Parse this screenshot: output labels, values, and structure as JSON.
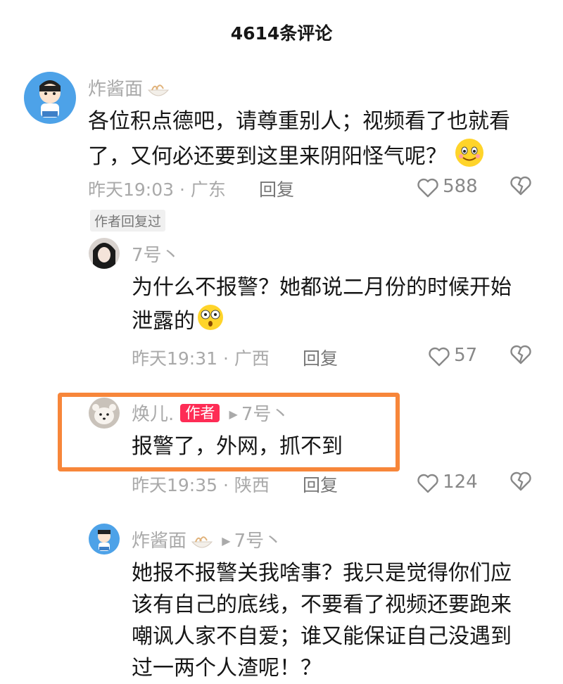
{
  "header": {
    "title": "4614条评论"
  },
  "comments": [
    {
      "user": "炸酱面",
      "text_lines": [
        "各位积点德吧，请尊重别人；视频看了也就看",
        "了，又何必还要到这里来阴阳怪气呢？"
      ],
      "meta": "昨天19:03 · 广东",
      "reply_label": "回复",
      "likes": "588",
      "author_replied": "作者回复过"
    }
  ],
  "replies": [
    {
      "user": "7号丶",
      "text_lines": [
        "为什么不报警？她都说二月份的时候开始",
        "泄露的"
      ],
      "meta": "昨天19:31 · 广西",
      "reply_label": "回复",
      "likes": "57"
    },
    {
      "user": "焕儿.",
      "badge": "作者",
      "reply_to": "7号丶",
      "text_lines": [
        "报警了，外网，抓不到"
      ],
      "meta": "昨天19:35 · 陕西",
      "reply_label": "回复",
      "likes": "124"
    },
    {
      "user": "炸酱面",
      "reply_to": "7号丶",
      "text_lines": [
        "她报不报警关我啥事？我只是觉得你们应",
        "该有自己的底线，不要看了视频还要跑来",
        "嘲讽人家不自爱；谁又能保证自己没遇到",
        "过一两个人渣呢！？"
      ]
    }
  ],
  "colors": {
    "author_badge": "#fe2c55",
    "highlight_border": "#f7863a",
    "secondary_text": "#a9a9a9"
  },
  "icons": [
    "heart-icon",
    "broken-heart-icon",
    "noodle-emoji-icon",
    "smile-emoji-icon",
    "shocked-emoji-icon",
    "reply-arrow-icon"
  ]
}
